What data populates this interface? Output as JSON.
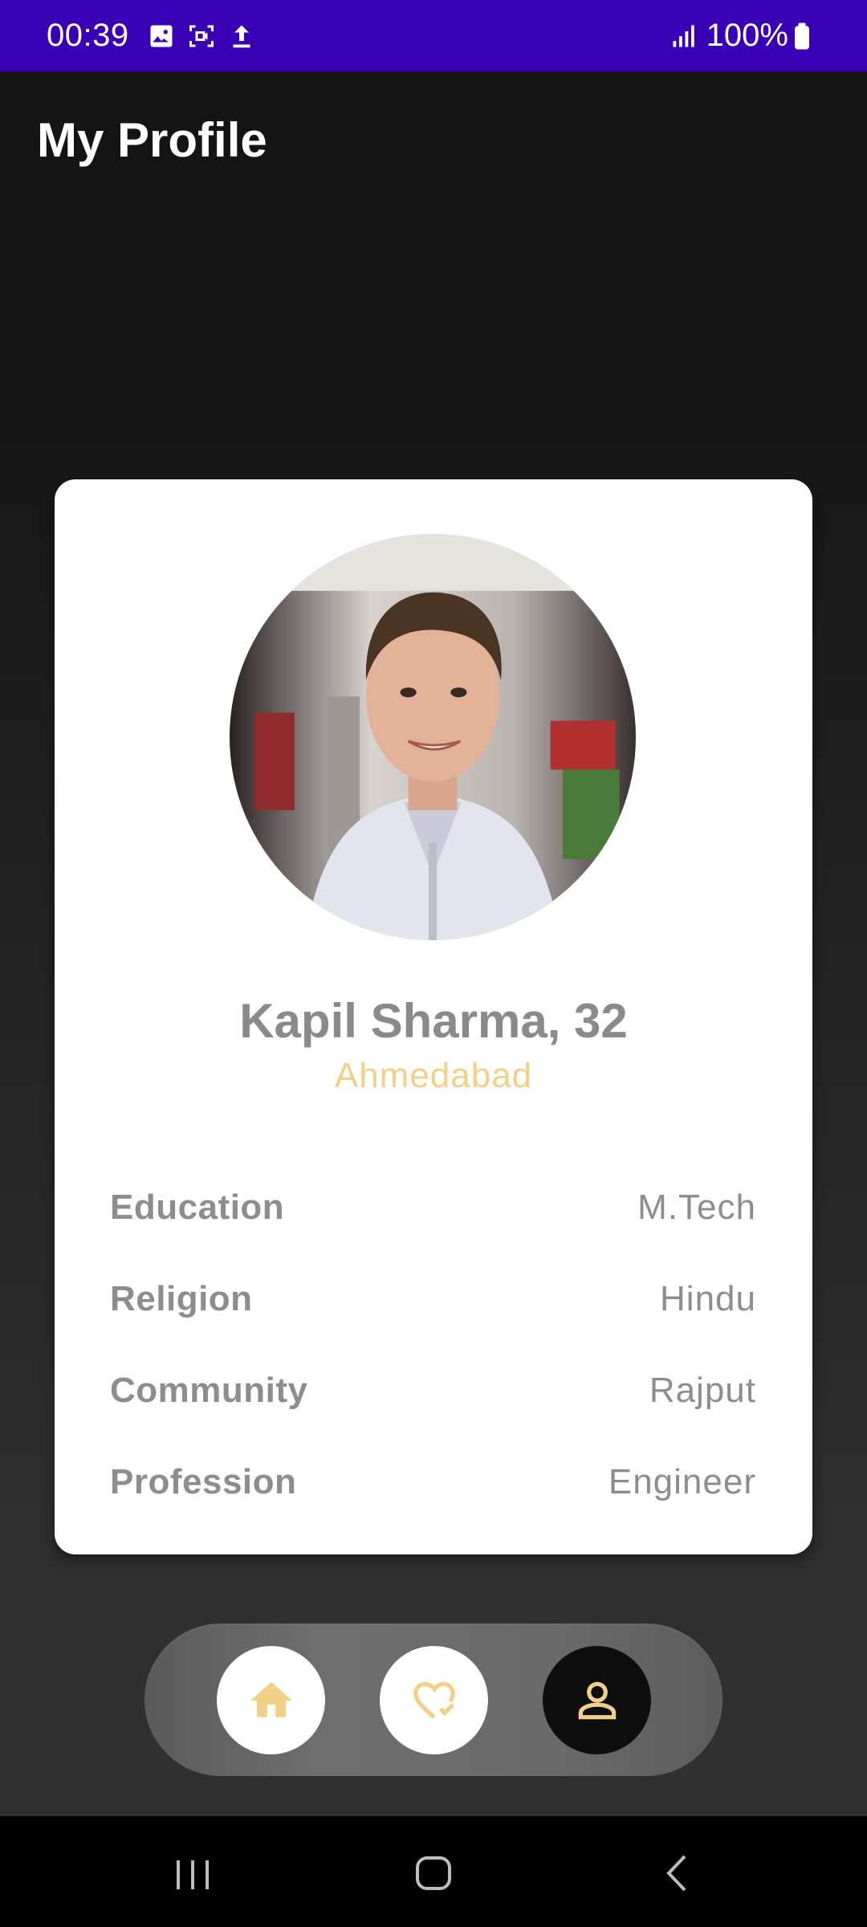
{
  "status_bar": {
    "time": "00:39",
    "battery": "100%",
    "icons": [
      "gallery-icon",
      "screen-record-icon",
      "upload-icon",
      "signal-icon",
      "battery-icon"
    ]
  },
  "app_bar": {
    "title": "My Profile"
  },
  "profile": {
    "name_age": "Kapil Sharma, 32",
    "location": "Ahmedabad",
    "details": [
      {
        "label": "Education",
        "value": "M.Tech"
      },
      {
        "label": "Religion",
        "value": "Hindu"
      },
      {
        "label": "Community",
        "value": "Rajput"
      },
      {
        "label": "Profession",
        "value": "Engineer"
      }
    ]
  },
  "bottom_nav": {
    "items": [
      {
        "name": "home",
        "icon": "home-icon",
        "active": false
      },
      {
        "name": "favorites",
        "icon": "heart-check-icon",
        "active": false
      },
      {
        "name": "profile",
        "icon": "person-icon",
        "active": true
      }
    ]
  },
  "colors": {
    "status_bar": "#3a00b5",
    "accent": "#f3d087",
    "card": "#ffffff",
    "text_muted": "#8d8d8d"
  }
}
